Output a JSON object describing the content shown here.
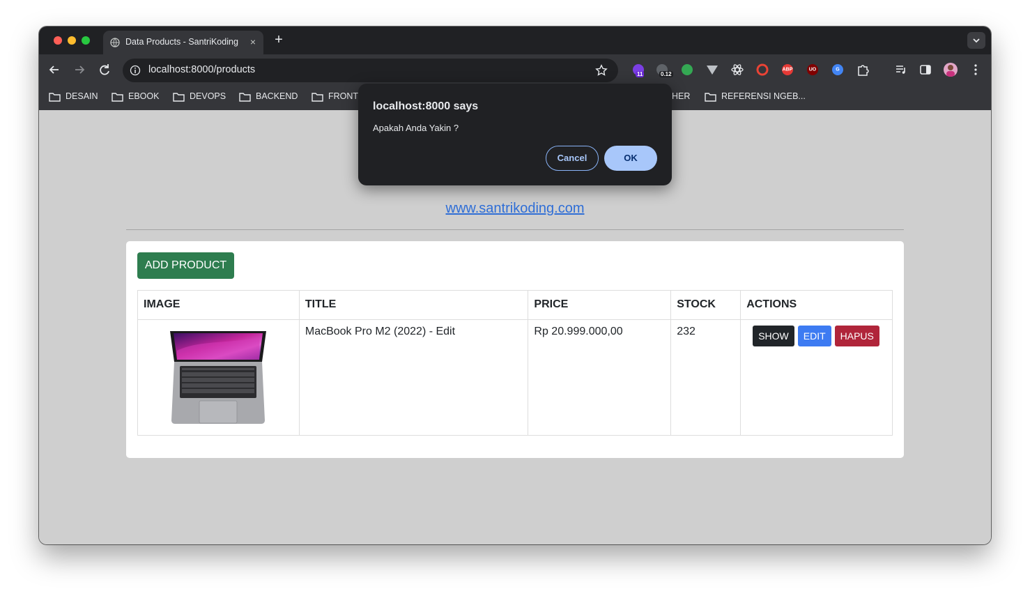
{
  "browser": {
    "tab": {
      "title": "Data Products - SantriKoding",
      "close_glyph": "×"
    },
    "new_tab_glyph": "+",
    "url": "localhost:8000/products",
    "extensions": [
      {
        "name": "extension-badge-icon",
        "badge": "11",
        "color": "#7b3fe4"
      },
      {
        "name": "extension-counter-icon",
        "badge": "0.12",
        "color": "#5f6368"
      },
      {
        "name": "green-dot-extension-icon",
        "color": "#34a853"
      },
      {
        "name": "vue-devtools-icon",
        "color": "#bdc1c6"
      },
      {
        "name": "react-devtools-icon",
        "color": "#e8eaed"
      },
      {
        "name": "color-picker-extension-icon",
        "color": "#ea4335"
      },
      {
        "name": "adblock-plus-icon",
        "badge": "ABP",
        "color": "#e53935"
      },
      {
        "name": "ublock-origin-icon",
        "badge": "UO",
        "color": "#800000"
      },
      {
        "name": "google-translate-icon",
        "badge": "G",
        "color": "#4285f4"
      },
      {
        "name": "extensions-puzzle-icon",
        "color": "#e8eaed"
      }
    ],
    "bookmarks": [
      "DESAIN",
      "EBOOK",
      "DEVOPS",
      "BACKEND",
      "FRONTI",
      "HER",
      "REFERENSI NGEB..."
    ]
  },
  "dialog": {
    "title": "localhost:8000 says",
    "message": "Apakah Anda Yakin ?",
    "cancel_label": "Cancel",
    "ok_label": "OK"
  },
  "page": {
    "site_link": "www.santrikoding.com",
    "add_button_label": "ADD PRODUCT",
    "table": {
      "headers": [
        "IMAGE",
        "TITLE",
        "PRICE",
        "STOCK",
        "ACTIONS"
      ],
      "rows": [
        {
          "title": "MacBook Pro M2 (2022) - Edit",
          "price": "Rp 20.999.000,00",
          "stock": "232",
          "image": "laptop-product-image"
        }
      ],
      "actions": {
        "show": "SHOW",
        "edit": "EDIT",
        "hapus": "HAPUS"
      }
    }
  },
  "colors": {
    "add_button": "#2e7d4f",
    "show_button": "#212529",
    "edit_button": "#3d7bf2",
    "hapus_button": "#b0253a",
    "link": "#2f6ed6",
    "dialog_ok": "#a8c7fa"
  }
}
